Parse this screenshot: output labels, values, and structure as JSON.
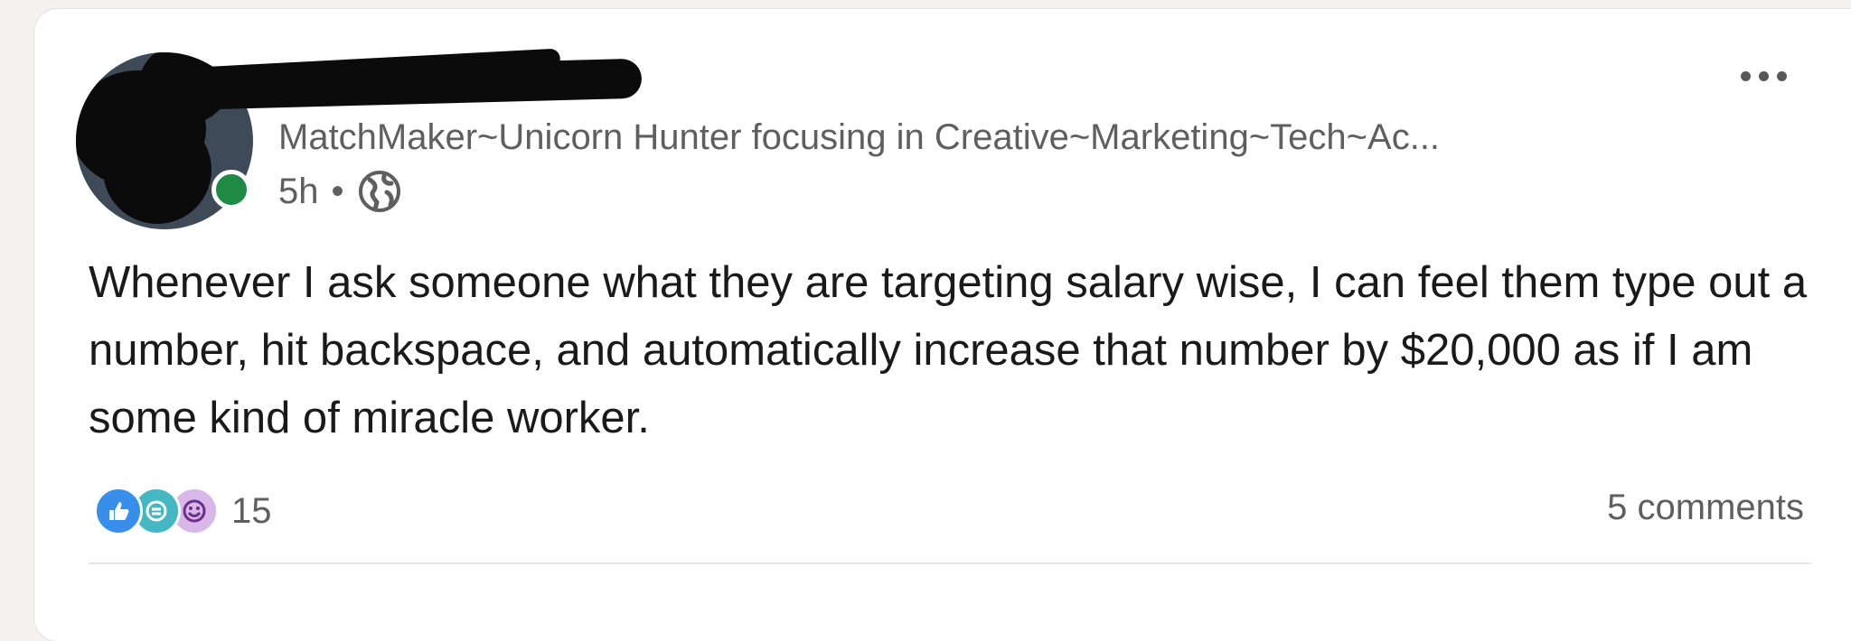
{
  "post": {
    "author_headline": "MatchMaker~Unicorn Hunter focusing in Creative~Marketing~Tech~Ac...",
    "time_ago": "5h",
    "separator": "•",
    "visibility_icon": "globe-icon",
    "body": "Whenever I ask someone what they are targeting salary wise, I can feel them type out a number, hit backspace, and automatically increase that number by $20,000 as if I am some kind of miracle worker.",
    "reactions": {
      "icons": [
        "like-reaction-icon",
        "celebrate-reaction-icon",
        "funny-reaction-icon"
      ],
      "count": "15"
    },
    "comments_label": "5 comments",
    "more_icon": "ellipsis-icon"
  },
  "colors": {
    "page_bg": "#f3f2ef",
    "card_bg": "#ffffff",
    "online_status": "#1e8a44",
    "like_blue": "#378fe9",
    "celebrate_teal": "#44b7c2",
    "funny_purple": "#d7b8e8"
  }
}
